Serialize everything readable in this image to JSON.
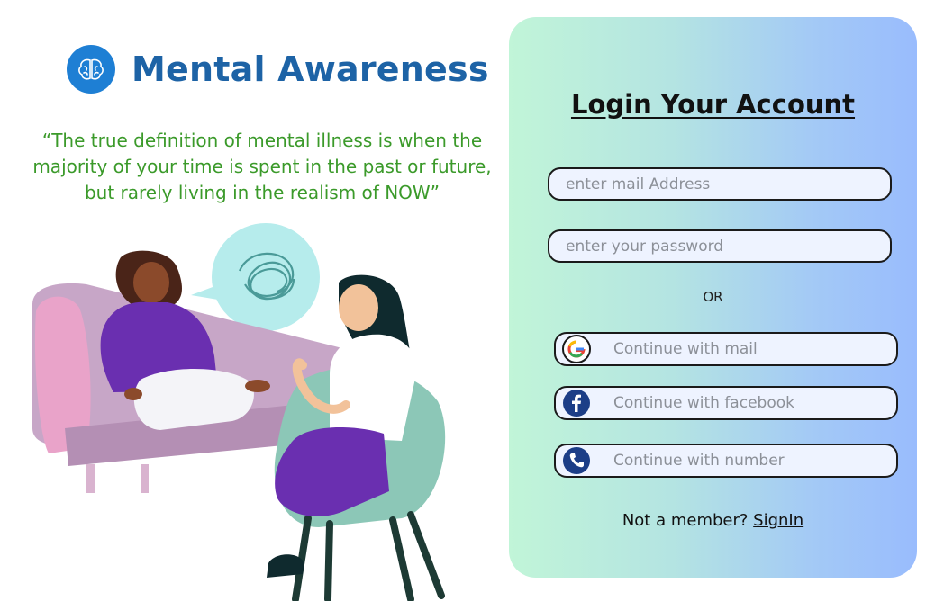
{
  "brand": {
    "title": "Mental Awareness"
  },
  "quote": "“The true definition of mental illness is when the majority of your time is spent in the past or future, but rarely living in the realism of NOW”",
  "login": {
    "title": "Login Your Account",
    "email_placeholder": "enter mail Address",
    "password_placeholder": "enter your password",
    "or_text": "OR",
    "social": [
      {
        "label": "Continue with mail",
        "icon": "google-icon"
      },
      {
        "label": "Continue with facebook",
        "icon": "facebook-icon"
      },
      {
        "label": "Continue with number",
        "icon": "phone-icon"
      }
    ],
    "footer_prefix": "Not a member?",
    "signin_link": "SignIn"
  },
  "colors": {
    "brand_blue": "#1d63a6",
    "quote_green": "#3b9a2a",
    "panel_gradient_start": "#c1f5d8",
    "panel_gradient_end": "#99bcfd"
  }
}
